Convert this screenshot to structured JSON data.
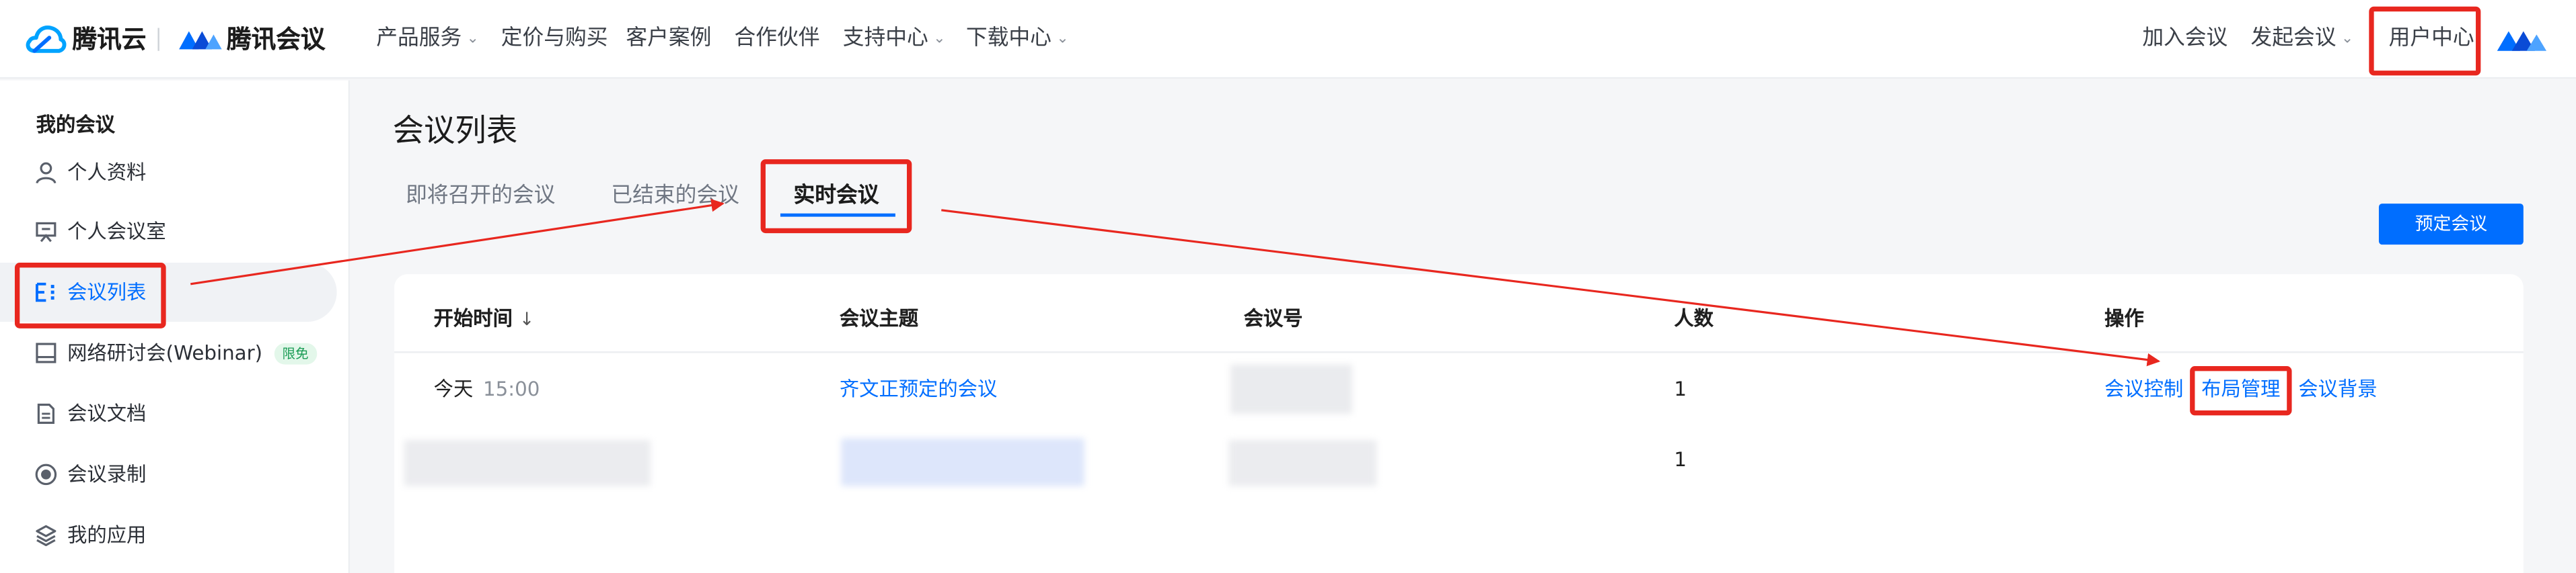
{
  "brand": {
    "cloud_name": "腾讯云",
    "meeting_name": "腾讯会议",
    "colors": {
      "primary": "#006eff",
      "annotation": "#e8271f",
      "badge_text": "#1a9c55"
    }
  },
  "topnav": {
    "items": [
      {
        "label": "产品服务",
        "dropdown": true
      },
      {
        "label": "定价与购买",
        "dropdown": false
      },
      {
        "label": "客户案例",
        "dropdown": false
      },
      {
        "label": "合作伙伴",
        "dropdown": false
      },
      {
        "label": "支持中心",
        "dropdown": true
      },
      {
        "label": "下载中心",
        "dropdown": true
      }
    ],
    "right": {
      "join": "加入会议",
      "start": "发起会议",
      "user_center": "用户中心"
    },
    "chevron": "⌄"
  },
  "sidebar": {
    "heading": "我的会议",
    "items": [
      {
        "label": "个人资料",
        "icon": "user-icon"
      },
      {
        "label": "个人会议室",
        "icon": "meeting-room-icon"
      },
      {
        "label": "会议列表",
        "icon": "list-icon",
        "active": true
      },
      {
        "label": "网络研讨会(Webinar)",
        "icon": "webinar-icon",
        "badge": "限免"
      },
      {
        "label": "会议文档",
        "icon": "document-icon"
      },
      {
        "label": "会议录制",
        "icon": "record-icon"
      },
      {
        "label": "我的应用",
        "icon": "apps-icon"
      }
    ]
  },
  "main": {
    "title": "会议列表",
    "tabs": [
      {
        "label": "即将召开的会议"
      },
      {
        "label": "已结束的会议"
      },
      {
        "label": "实时会议",
        "active": true
      }
    ],
    "schedule_button": "预定会议",
    "table": {
      "columns": [
        "开始时间",
        "会议主题",
        "会议号",
        "人数",
        "操作"
      ],
      "sort_indicator": "↓",
      "rows": [
        {
          "date": "今天",
          "time": "15:00",
          "topic": "齐文正预定的会议",
          "participants": "1",
          "actions": [
            "会议控制",
            "布局管理",
            "会议背景"
          ]
        },
        {
          "participants": "1"
        }
      ]
    }
  }
}
